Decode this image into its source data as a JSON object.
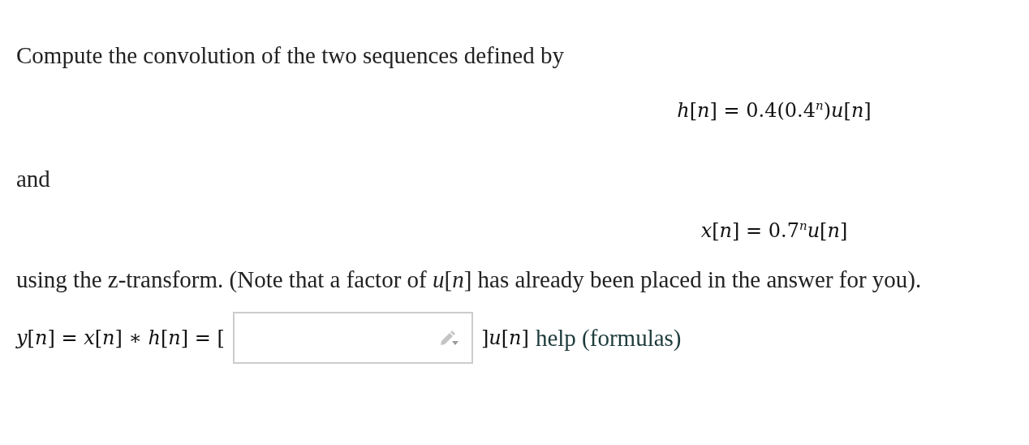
{
  "blocks": [
    {
      "kind": "text",
      "text": "Compute the convolution of the two sequences defined by"
    },
    {
      "kind": "equation",
      "text": "*h*[*n*] = 0.4(0.4$^{n}$)*u*[*n*]"
    },
    {
      "kind": "text",
      "text": "and"
    },
    {
      "kind": "equation",
      "text": "*x*[*n*] = 0.7$^{n}$*u*[*n*]"
    },
    {
      "kind": "text",
      "text": "using the z-transform. (Note that a factor of *u*[*n*] has already been placed in the answer for you)."
    }
  ],
  "answer": {
    "prefix": "*y*[*n*] = *x*[*n*] ∗ *h*[*n*] = [",
    "suffix": "]*u*[*n*]",
    "link": "help (formulas)"
  }
}
